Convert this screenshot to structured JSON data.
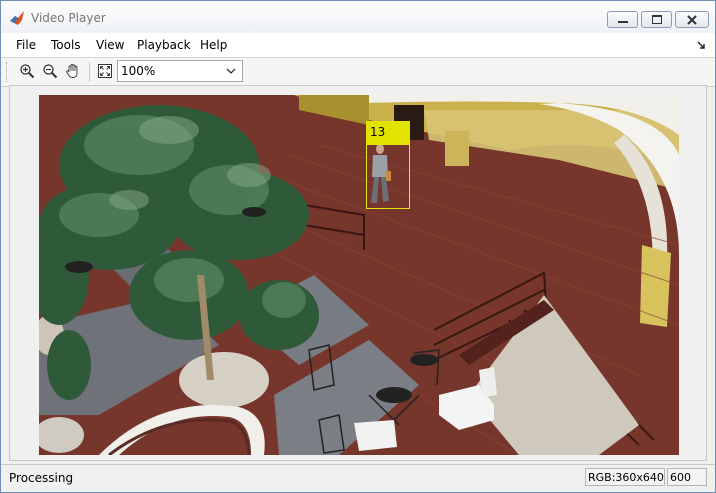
{
  "window": {
    "title": "Video Player"
  },
  "menu": {
    "items": [
      "File",
      "Tools",
      "View",
      "Playback",
      "Help"
    ]
  },
  "toolbar": {
    "zoom_value": "100%",
    "icons": [
      "zoom-in-icon",
      "zoom-out-icon",
      "pan-hand-icon",
      "fit-to-window-icon"
    ]
  },
  "video": {
    "track_id": "13",
    "track_color": "#e3e300"
  },
  "status": {
    "text": "Processing",
    "resolution": "RGB:360x640",
    "frame": "600"
  },
  "colors": {
    "title_text": "#777777",
    "window_border": "#6f8fb5"
  }
}
